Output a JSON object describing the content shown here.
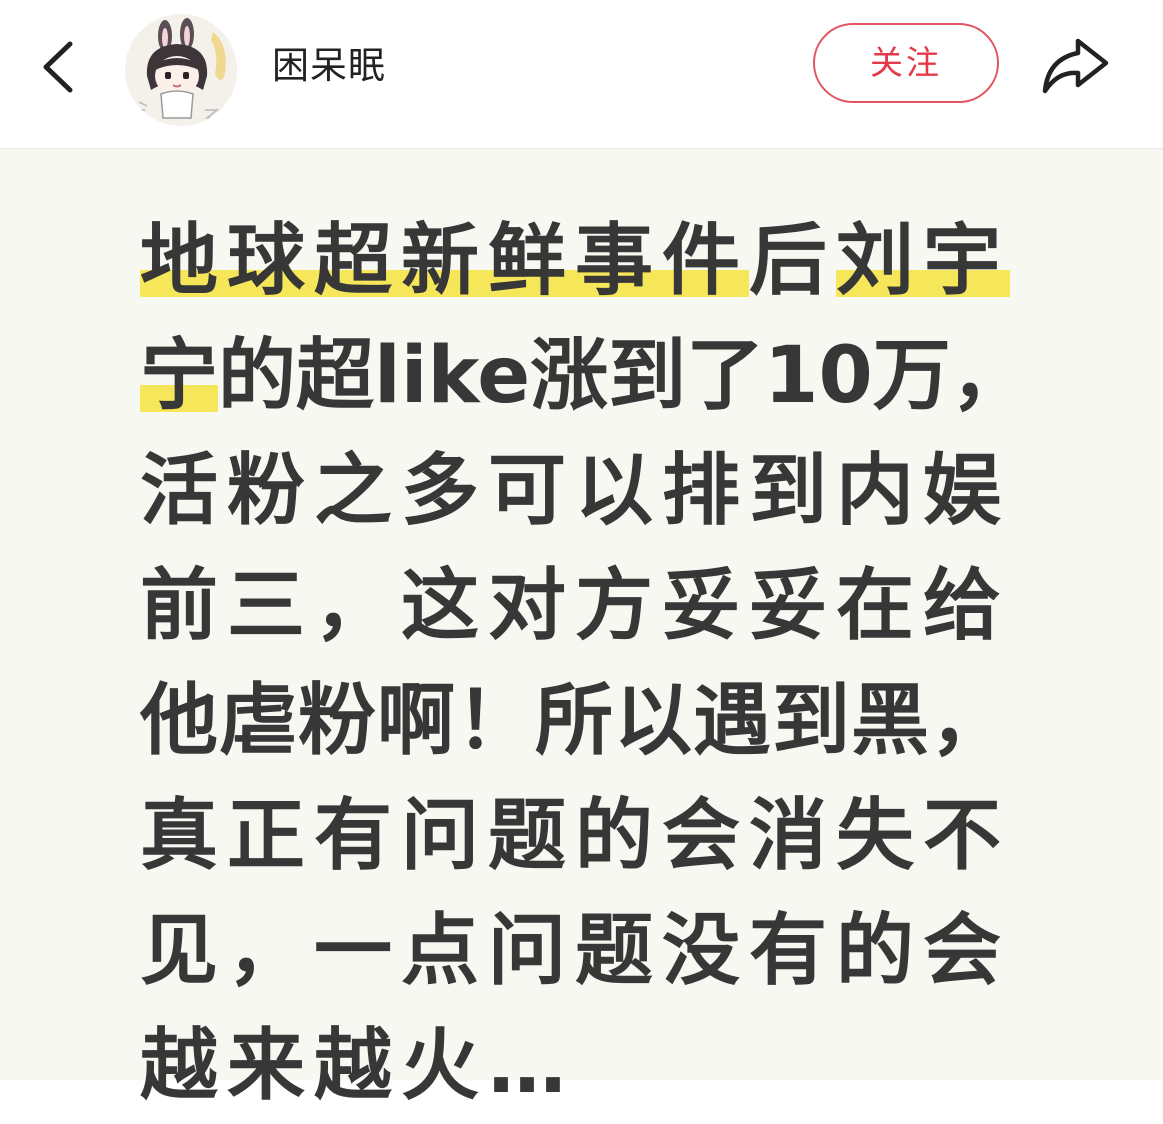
{
  "header": {
    "username": "困呆眠",
    "follow_label": "关注"
  },
  "post": {
    "line1_hl1": "地球超新鲜事件",
    "line1_mid": "后",
    "line1_hl2": "刘宇",
    "line2_hl": "宁",
    "line2_rest": "的超like涨到了10万，",
    "line3": "活粉之多可以排到内娱",
    "line4": "前三，这对方妥妥在给",
    "line5": "他虐粉啊！所以遇到黑，",
    "line6": "真正有问题的会消失不",
    "line7": "见，一点问题没有的会",
    "line8": "越来越火…"
  },
  "colors": {
    "highlight": "#f6e75a",
    "follow_accent": "#e23a48",
    "text": "#373737",
    "card_bg": "#f8f8f3"
  },
  "icons": {
    "back": "chevron-left-icon",
    "share": "share-arrow-icon"
  }
}
